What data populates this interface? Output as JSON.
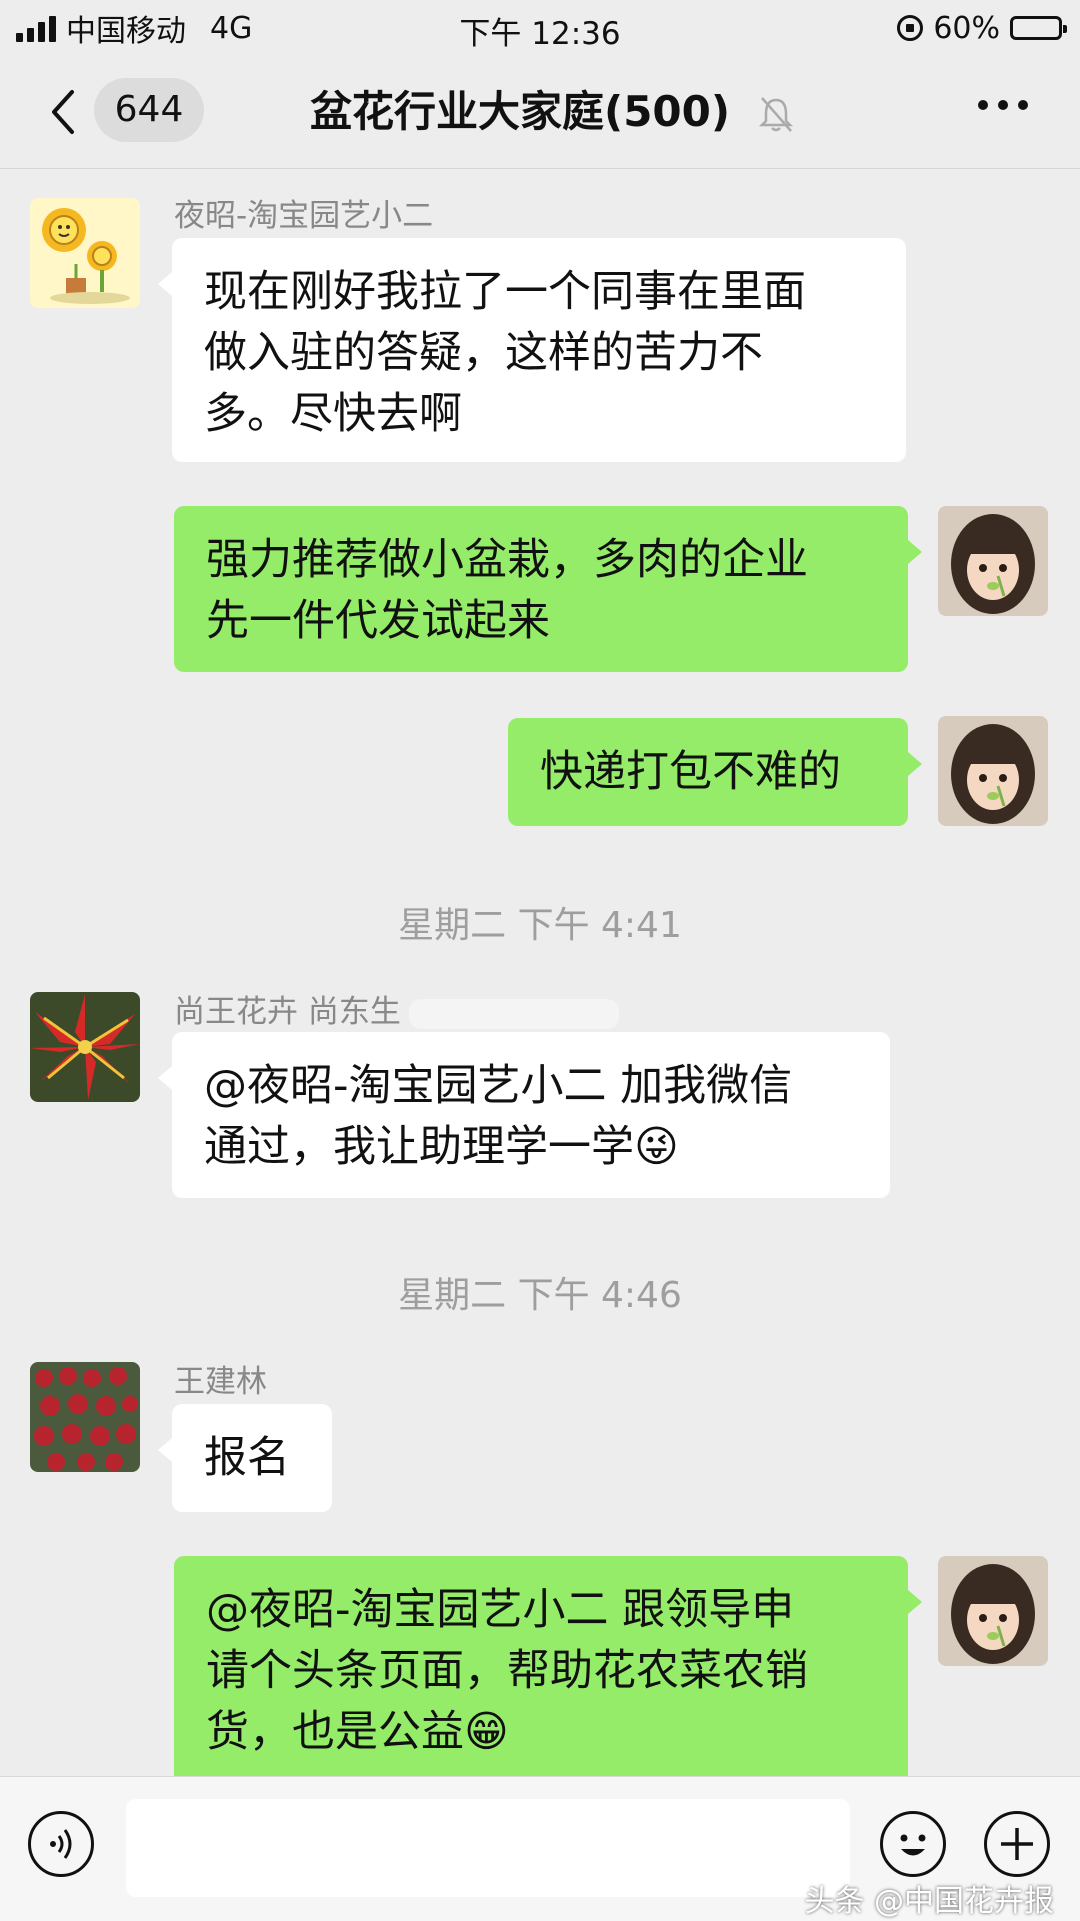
{
  "status_bar": {
    "carrier": "中国移动",
    "network": "4G",
    "time": "下午 12:36",
    "battery_percent": "60%",
    "battery_level": 0.6
  },
  "nav": {
    "back_icon": "chevron-left-icon",
    "unread_count": "644",
    "title": "盆花行业大家庭(500)",
    "mute_icon": "bell-off-icon",
    "more_icon": "more-dots-icon"
  },
  "messages": [
    {
      "side": "left",
      "sender": "夜昭-淘宝园艺小二",
      "avatar": "sunflower-cartoon-avatar",
      "lines": [
        "现在刚好我拉了一个同事在里面",
        "做入驻的答疑，这样的苦力不",
        "多。尽快去啊"
      ]
    },
    {
      "side": "right",
      "avatar": "girl-photo-avatar",
      "lines": [
        "强力推荐做小盆栽，多肉的企业",
        "先一件代发试起来"
      ]
    },
    {
      "side": "right",
      "avatar": "girl-photo-avatar",
      "lines": [
        "快递打包不难的"
      ]
    },
    {
      "side": "left",
      "sender": "尚王花卉 尚东生",
      "avatar": "red-bromeliad-avatar",
      "lines": [
        "@夜昭-淘宝园艺小二 加我微信",
        "通过，我让助理学一学"
      ],
      "emoji": "😜"
    },
    {
      "side": "left",
      "sender": "王建林",
      "avatar": "potted-flowers-avatar",
      "lines": [
        "报名"
      ]
    },
    {
      "side": "right",
      "avatar": "girl-photo-avatar",
      "lines": [
        "@夜昭-淘宝园艺小二 跟领导申",
        "请个头条页面，帮助花农菜农销",
        "货，也是公益"
      ],
      "emoji": "😁"
    }
  ],
  "timestamps": [
    "星期二 下午 4:41",
    "星期二 下午 4:46"
  ],
  "input_bar": {
    "voice_icon": "voice-icon",
    "emoji_icon": "smiley-icon",
    "plus_icon": "plus-icon",
    "value": ""
  },
  "watermark": "头条 @中国花卉报",
  "colors": {
    "outgoing_bubble": "#95ec69",
    "incoming_bubble": "#ffffff",
    "background": "#ededed"
  }
}
